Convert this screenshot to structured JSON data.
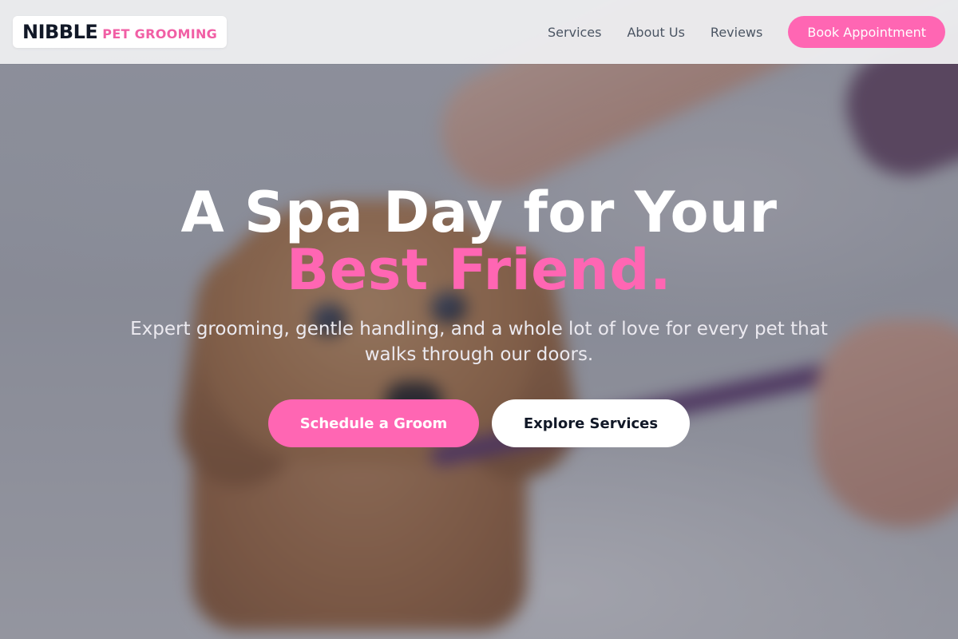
{
  "brand": {
    "name": "NIBBLE",
    "tagline": "PET GROOMING"
  },
  "nav": {
    "links": [
      {
        "label": "Services"
      },
      {
        "label": "About Us"
      },
      {
        "label": "Reviews"
      }
    ],
    "cta_label": "Book Appointment"
  },
  "hero": {
    "headline_line1": "A Spa Day for Your",
    "headline_line2": "Best Friend.",
    "subtext": "Expert grooming, gentle handling, and a whole lot of love for every pet that walks through our doors.",
    "primary_button": "Schedule a Groom",
    "secondary_button": "Explore Services",
    "background_image": "wet-puppy-on-leash-photo"
  },
  "colors": {
    "accent_pink": "#ff66b3",
    "dark_text": "#111827",
    "nav_text": "#4b5563"
  }
}
